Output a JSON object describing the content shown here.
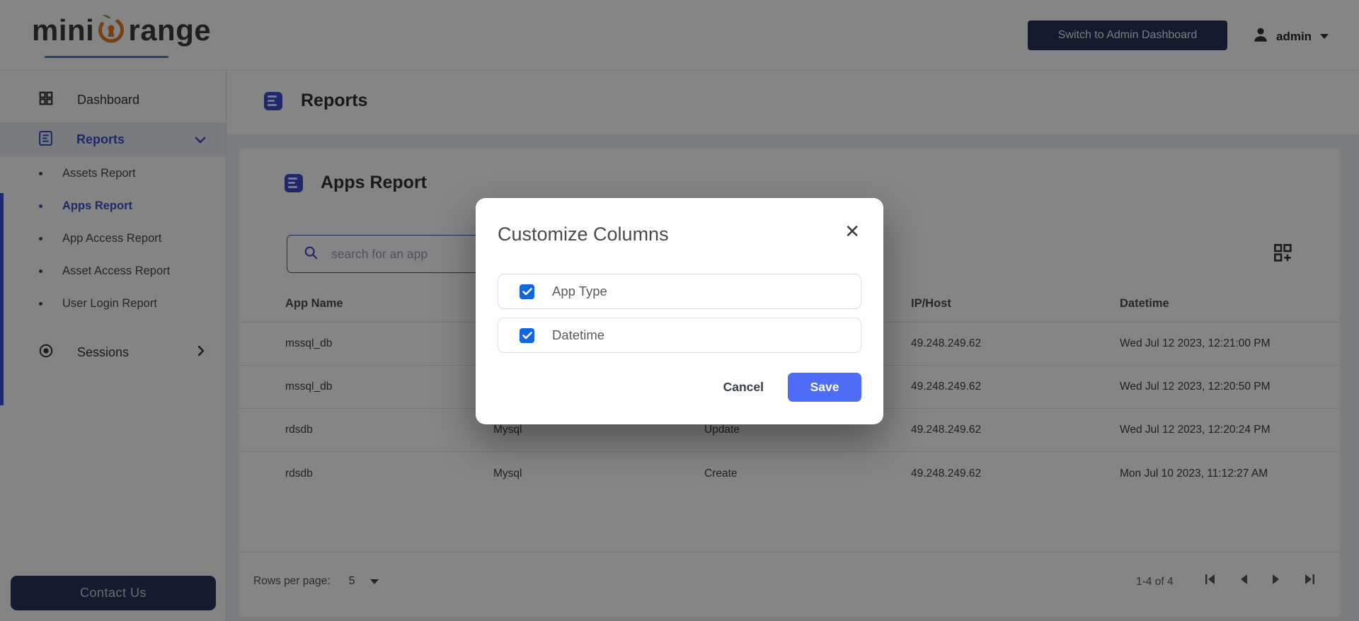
{
  "brand": {
    "name_prefix": "mini",
    "name_suffix": "range",
    "orange": "#e07c24",
    "leaf_green": "#6aa84f",
    "underline_blue": "#4f81bd"
  },
  "header": {
    "switch_button_label": "Switch to Admin Dashboard",
    "user_name": "admin"
  },
  "sidebar": {
    "dashboard_label": "Dashboard",
    "reports_label": "Reports",
    "reports_children": [
      {
        "label": "Assets Report",
        "active": false
      },
      {
        "label": "Apps Report",
        "active": true
      },
      {
        "label": "App Access Report",
        "active": false
      },
      {
        "label": "Asset Access Report",
        "active": false
      },
      {
        "label": "User Login Report",
        "active": false
      }
    ],
    "sessions_label": "Sessions",
    "contact_button_label": "Contact Us"
  },
  "page": {
    "title": "Reports"
  },
  "card": {
    "title": "Apps Report",
    "search_placeholder": "search for an app",
    "table": {
      "columns": [
        "App Name",
        "",
        "",
        "IP/Host",
        "Datetime"
      ],
      "rows": [
        [
          "mssql_db",
          "",
          "",
          "49.248.249.62",
          "Wed Jul 12 2023, 12:21:00 PM"
        ],
        [
          "mssql_db",
          "",
          "",
          "49.248.249.62",
          "Wed Jul 12 2023, 12:20:50 PM"
        ],
        [
          "rdsdb",
          "Mysql",
          "Update",
          "49.248.249.62",
          "Wed Jul 12 2023, 12:20:24 PM"
        ],
        [
          "rdsdb",
          "Mysql",
          "Create",
          "49.248.249.62",
          "Mon Jul 10 2023, 11:12:27 AM"
        ]
      ]
    },
    "footer": {
      "rows_per_page_label": "Rows per page:",
      "rows_per_page_value": "5",
      "range_label": "1-4 of 4"
    }
  },
  "modal": {
    "title": "Customize Columns",
    "close_glyph": "✕",
    "options": [
      {
        "label": "App Type",
        "checked": true
      },
      {
        "label": "Datetime",
        "checked": true
      }
    ],
    "cancel_label": "Cancel",
    "save_label": "Save"
  },
  "colors": {
    "accent_indigo": "#3d4ec9",
    "save_blue": "#4e6cf5",
    "checkbox_blue": "#1266e0",
    "navy_button": "#2a3557",
    "backdrop": "rgba(0,0,0,0.48)"
  }
}
